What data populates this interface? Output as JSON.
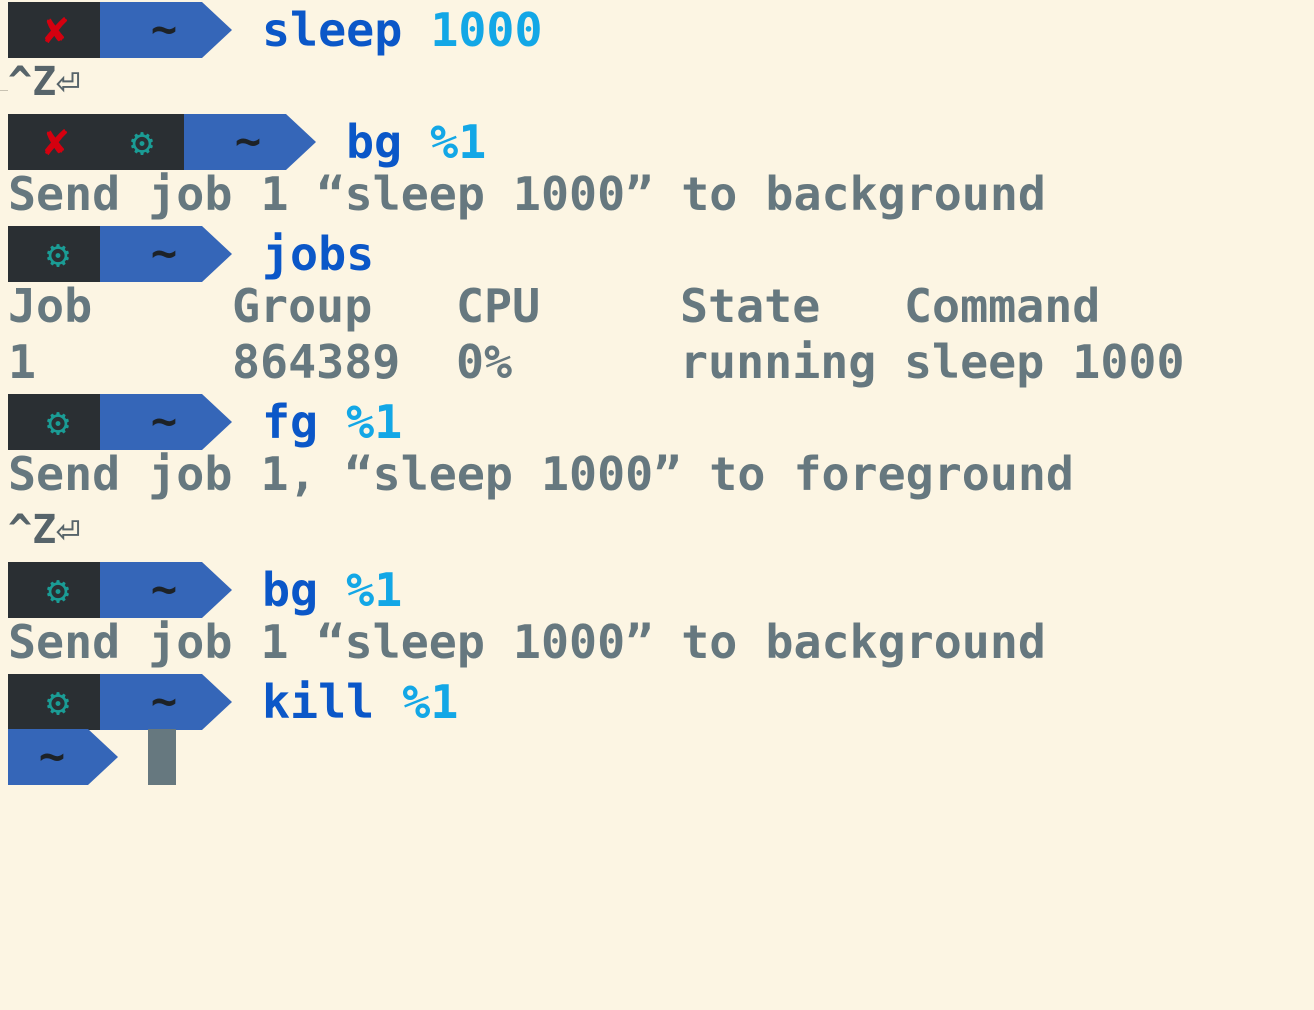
{
  "prompt": {
    "error_symbol": "✘",
    "jobs_symbol": "⚙",
    "cwd": "~"
  },
  "colors": {
    "background": "#fcf5e3",
    "command": "#0b57c8",
    "argument": "#13a7e6",
    "output": "#66787f",
    "error": "#d4000f",
    "jobs": "#1a9c95",
    "segment_dark": "#2a2f33",
    "segment_blue": "#3566b8"
  },
  "session": {
    "cmd1": {
      "command": "sleep",
      "arg": "1000"
    },
    "ctrlz_1": "^Z⏎",
    "cmd2": {
      "command": "bg",
      "arg": "%1"
    },
    "out2": "Send job 1 “sleep 1000” to background",
    "cmd3": {
      "command": "jobs",
      "arg": ""
    },
    "jobs_table": {
      "headers": [
        "Job",
        "Group",
        "CPU",
        "State",
        "Command"
      ],
      "rows": [
        [
          "1",
          "864389",
          "0%",
          "running",
          "sleep 1000"
        ]
      ]
    },
    "cmd4": {
      "command": "fg",
      "arg": "%1"
    },
    "out4": "Send job 1, “sleep 1000” to foreground",
    "ctrlz_2": "^Z⏎",
    "cmd5": {
      "command": "bg",
      "arg": "%1"
    },
    "out5": "Send job 1 “sleep 1000” to background",
    "cmd6": {
      "command": "kill",
      "arg": "%1"
    }
  }
}
